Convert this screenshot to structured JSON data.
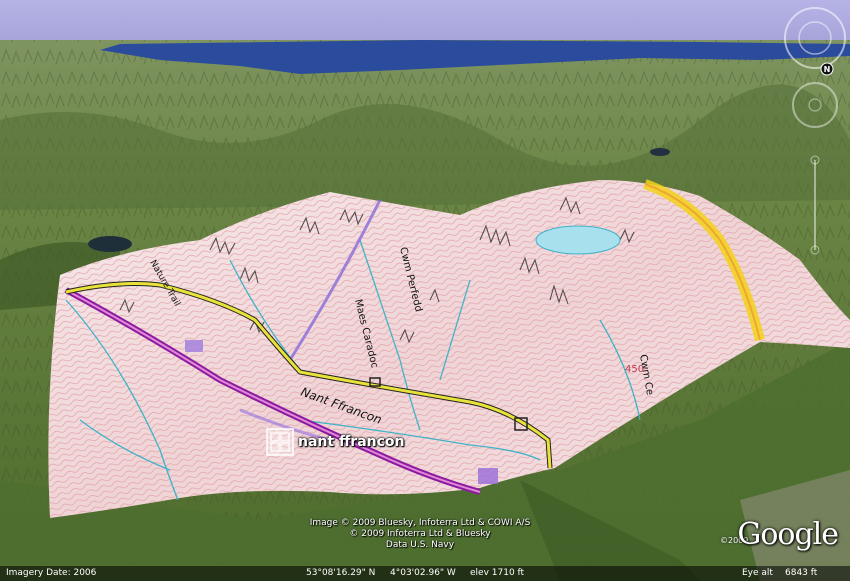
{
  "placemark": {
    "label": "nant ffrancon"
  },
  "attribution": {
    "line1": "Image © 2009 Bluesky, Infoterra Ltd & COWI A/S",
    "line2": "© 2009 Infoterra Ltd & Bluesky",
    "line3": "Data U.S. Navy"
  },
  "logo": {
    "text": "Google",
    "year": "©2009"
  },
  "status": {
    "imagery_date_label": "Imagery Date: 2006",
    "latitude": "53°08'16.29\" N",
    "longitude": "4°03'02.96\" W",
    "elevation": "elev  1710 ft",
    "eye_alt_label": "Eye alt",
    "eye_alt_value": "6843 ft"
  },
  "map_labels": {
    "nant_ffrancon_road": "Nant Ffrancon",
    "cwm_perfedd": "Cwm Perfedd",
    "maes_caradoc": "Maes Caradoc",
    "cwm_cel": "Cwm Ce",
    "contour_450": "450",
    "trail": "Nature Trail"
  },
  "compass": {
    "north_letter": "N"
  },
  "colors": {
    "sky": "#a9a6dc",
    "sea": "#2a4a9a",
    "terrain": "#5e7a3a",
    "map_overlay": "#f1dcdc",
    "road_purple": "#8c1aa0",
    "path_yellow": "#e8e23a",
    "boundary_yellow": "#f2d21a"
  }
}
